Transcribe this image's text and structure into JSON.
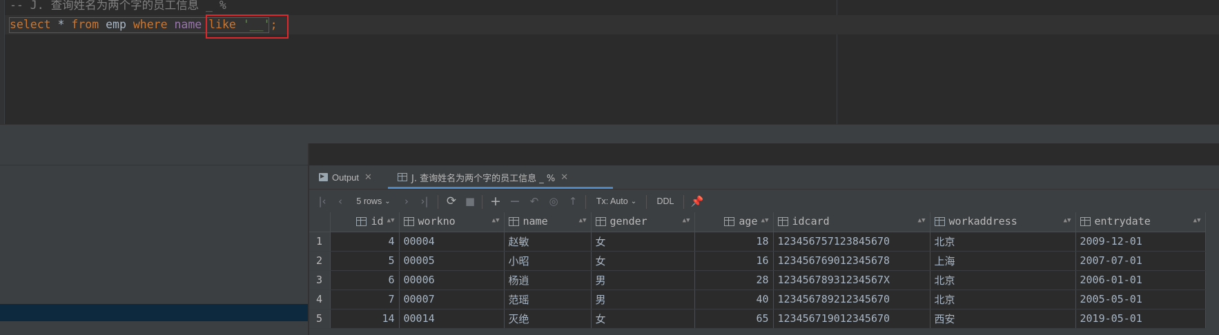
{
  "editor": {
    "comment_line": "-- J. 查询姓名为两个字的员工信息 _ %",
    "sql_tokens": {
      "select": "select",
      "star": " * ",
      "from": "from",
      "table": " emp ",
      "where": "where",
      "column": " name ",
      "like": "like",
      "space": " ",
      "pattern": "'__'",
      "semicolon": ";"
    }
  },
  "results": {
    "tabs": [
      {
        "label": "Output",
        "icon": "console-icon"
      },
      {
        "label": "J. 查询姓名为两个字的员工信息 _ %",
        "icon": "table-icon"
      }
    ],
    "toolbar": {
      "rows_label": "5 rows",
      "tx_label": "Tx: Auto",
      "ddl_label": "DDL"
    },
    "columns": [
      "id",
      "workno",
      "name",
      "gender",
      "age",
      "idcard",
      "workaddress",
      "entrydate"
    ],
    "rows": [
      {
        "n": "1",
        "id": "4",
        "workno": "00004",
        "name": "赵敏",
        "gender": "女",
        "age": "18",
        "idcard": "123456757123845670",
        "workaddress": "北京",
        "entrydate": "2009-12-01"
      },
      {
        "n": "2",
        "id": "5",
        "workno": "00005",
        "name": "小昭",
        "gender": "女",
        "age": "16",
        "idcard": "123456769012345678",
        "workaddress": "上海",
        "entrydate": "2007-07-01"
      },
      {
        "n": "3",
        "id": "6",
        "workno": "00006",
        "name": "杨逍",
        "gender": "男",
        "age": "28",
        "idcard": "12345678931234567X",
        "workaddress": "北京",
        "entrydate": "2006-01-01"
      },
      {
        "n": "4",
        "id": "7",
        "workno": "00007",
        "name": "范瑶",
        "gender": "男",
        "age": "40",
        "idcard": "123456789212345670",
        "workaddress": "北京",
        "entrydate": "2005-05-01"
      },
      {
        "n": "5",
        "id": "14",
        "workno": "00014",
        "name": "灭绝",
        "gender": "女",
        "age": "65",
        "idcard": "123456719012345670",
        "workaddress": "西安",
        "entrydate": "2019-05-01"
      }
    ]
  }
}
